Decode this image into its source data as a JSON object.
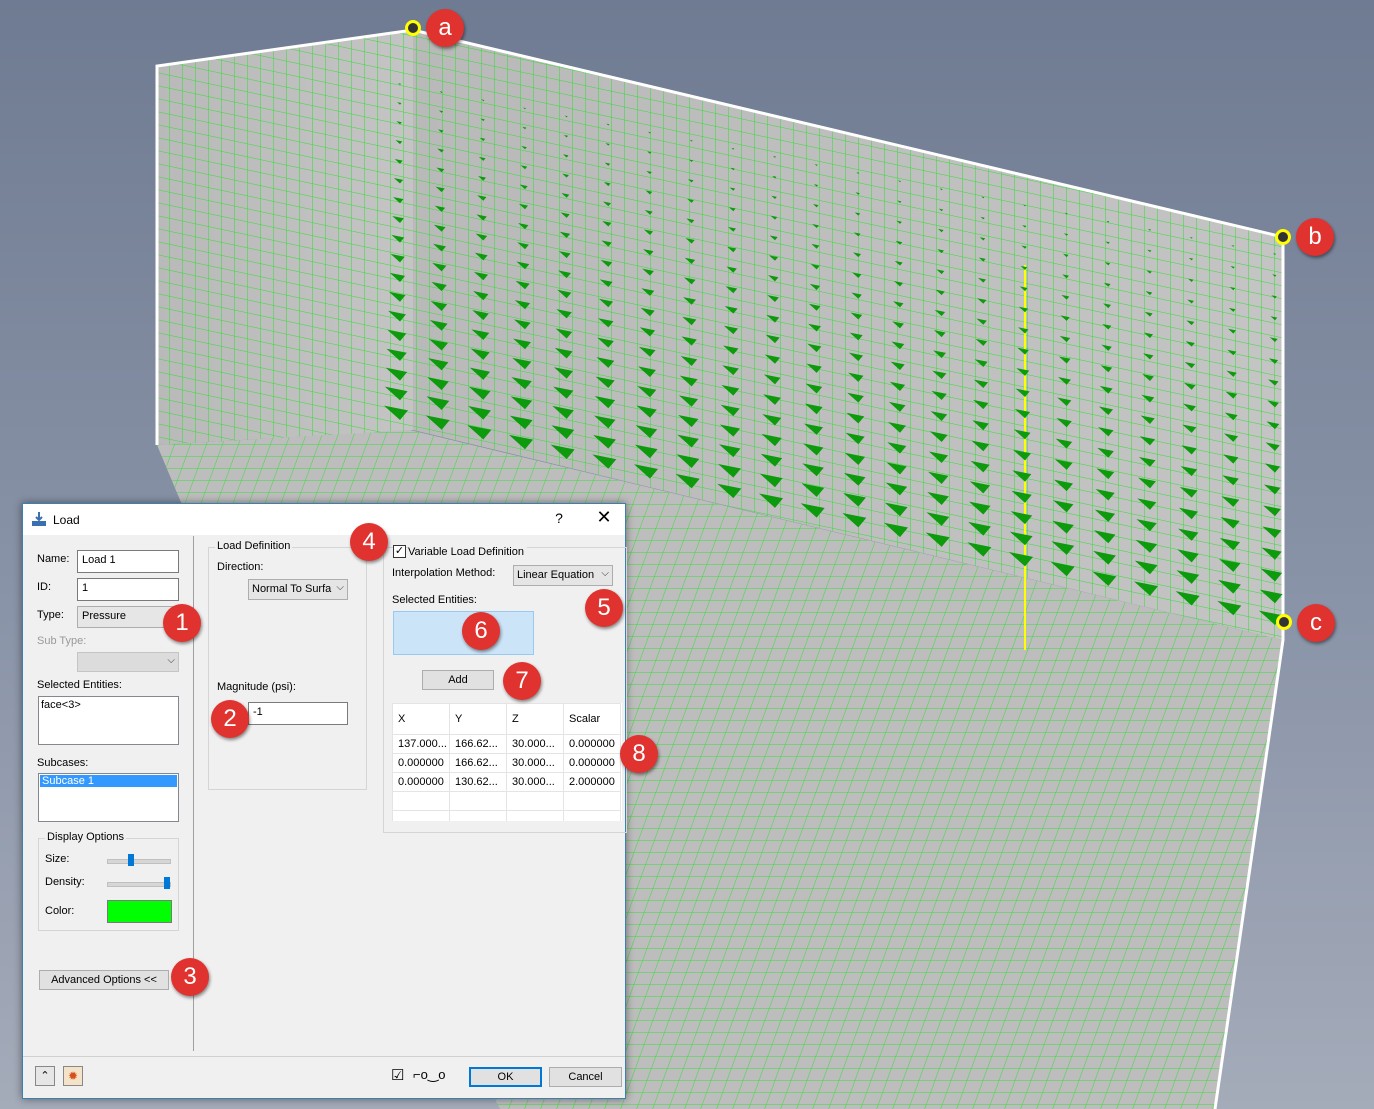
{
  "dialog": {
    "title": "Load",
    "help_glyph": "?",
    "close_glyph": "✕",
    "name_label": "Name:",
    "name_value": "Load 1",
    "id_label": "ID:",
    "id_value": "1",
    "type_label": "Type:",
    "type_value": "Pressure",
    "subtype_label": "Sub Type:",
    "selected_entities_label": "Selected Entities:",
    "selected_entities_value": "face<3>",
    "subcases_label": "Subcases:",
    "subcases_items": [
      "Subcase 1"
    ],
    "display_options": {
      "title": "Display Options",
      "size_label": "Size:",
      "size_level": 0.35,
      "density_label": "Density:",
      "density_level": 1.0,
      "color_label": "Color:",
      "color": "#00ff00"
    },
    "advanced_button": "Advanced Options <<",
    "load_definition": {
      "title": "Load Definition",
      "direction_label": "Direction:",
      "direction_value": "Normal To Surfa",
      "magnitude_label": "Magnitude (psi):",
      "magnitude_value": "-1"
    },
    "variable": {
      "checkbox_label": "Variable Load Definition",
      "checked": true,
      "interp_label": "Interpolation Method:",
      "interp_value": "Linear Equation",
      "selected_entities_label": "Selected Entities:",
      "add_button": "Add",
      "columns": [
        "X",
        "Y",
        "Z",
        "Scalar"
      ],
      "rows": [
        [
          "137.000...",
          "166.62...",
          "30.000...",
          "0.000000"
        ],
        [
          "0.000000",
          "166.62...",
          "30.000...",
          "0.000000"
        ],
        [
          "0.000000",
          "130.62...",
          "30.000...",
          "2.000000"
        ],
        [
          "",
          "",
          "",
          ""
        ],
        [
          "",
          "",
          "",
          ""
        ]
      ]
    },
    "footer": {
      "check_glyph": "☑",
      "glasses_glyph": "⌐o‿o",
      "ok": "OK",
      "cancel": "Cancel"
    }
  },
  "callouts": {
    "a": "a",
    "b": "b",
    "c": "c",
    "n1": "1",
    "n2": "2",
    "n3": "3",
    "n4": "4",
    "n5": "5",
    "n6": "6",
    "n7": "7",
    "n8": "8"
  },
  "colors": {
    "mesh_line": "#33dd33",
    "arrow": "#0d9a0d",
    "callout": "#e0322e",
    "marker": "#ffff00"
  }
}
